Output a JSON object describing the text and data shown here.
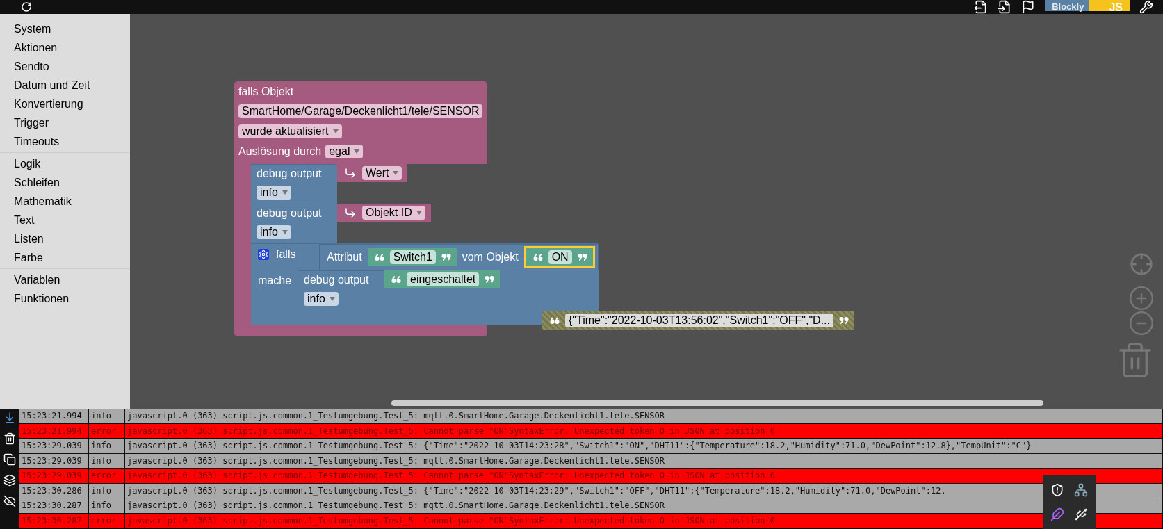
{
  "toolbar": {
    "logo": {
      "left": "Blockly",
      "right": "JS"
    }
  },
  "sidebar": {
    "groups": [
      {
        "items": [
          "System",
          "Aktionen",
          "Sendto",
          "Datum und Zeit",
          "Konvertierung",
          "Trigger",
          "Timeouts"
        ]
      },
      {
        "items": [
          "Logik",
          "Schleifen",
          "Mathematik",
          "Text",
          "Listen",
          "Farbe"
        ]
      },
      {
        "items": [
          "Variablen",
          "Funktionen"
        ]
      }
    ]
  },
  "workspace": {
    "event_block": {
      "title": "falls Objekt",
      "object_id": "SmartHome/Garage/Deckenlicht1/tele/SENSOR",
      "trigger": "wurde aktualisiert",
      "cause_label": "Auslösung durch",
      "cause": "egal",
      "statements": [
        {
          "kind": "debug",
          "label": "debug output",
          "severity": "info",
          "value": {
            "kind": "variable",
            "text": "Wert"
          }
        },
        {
          "kind": "debug",
          "label": "debug output",
          "severity": "info",
          "value": {
            "kind": "variable",
            "text": "Objekt ID"
          }
        },
        {
          "kind": "if",
          "label": "falls",
          "do_label": "mache",
          "condition": {
            "label": "Attribut",
            "attribute": {
              "text": "Switch1",
              "selected": false
            },
            "of_label": "vom Objekt",
            "object": {
              "text": "ON",
              "selected": true
            }
          },
          "statements": [
            {
              "kind": "debug",
              "label": "debug output",
              "severity": "info",
              "value": {
                "kind": "text",
                "text": "eingeschaltet"
              }
            }
          ]
        }
      ]
    },
    "loose_blocks": [
      {
        "kind": "text",
        "text": "{\"Time\":\"2022-10-03T13:56:02\",\"Switch1\":\"OFF\",\"D..."
      }
    ]
  },
  "log": [
    {
      "kind": "info",
      "time": "15:23:21.994",
      "severity": "info",
      "message": "javascript.0 (363) script.js.common.1_Testumgebung.Test_5: mqtt.0.SmartHome.Garage.Deckenlicht1.tele.SENSOR"
    },
    {
      "kind": "error",
      "time": "15:23:21.994",
      "severity": "error",
      "message": "javascript.0 (363) script.js.common.1_Testumgebung.Test_5: Cannot parse \"ON\"SyntaxError: Unexpected token O in JSON at position 0"
    },
    {
      "kind": "info",
      "time": "15:23:29.039",
      "severity": "info",
      "message": "javascript.0 (363) script.js.common.1_Testumgebung.Test_5: {\"Time\":\"2022-10-03T14:23:28\",\"Switch1\":\"ON\",\"DHT11\":{\"Temperature\":18.2,\"Humidity\":71.0,\"DewPoint\":12.8},\"TempUnit\":\"C\"}"
    },
    {
      "kind": "info",
      "time": "15:23:29.039",
      "severity": "info",
      "message": "javascript.0 (363) script.js.common.1_Testumgebung.Test_5: mqtt.0.SmartHome.Garage.Deckenlicht1.tele.SENSOR"
    },
    {
      "kind": "error",
      "time": "15:23:29.039",
      "severity": "error",
      "message": "javascript.0 (363) script.js.common.1_Testumgebung.Test_5: Cannot parse \"ON\"SyntaxError: Unexpected token O in JSON at position 0"
    },
    {
      "kind": "info",
      "time": "15:23:30.286",
      "severity": "info",
      "message": "javascript.0 (363) script.js.common.1_Testumgebung.Test_5: {\"Time\":\"2022-10-03T14:23:29\",\"Switch1\":\"OFF\",\"DHT11\":{\"Temperature\":18.2,\"Humidity\":71.0,\"DewPoint\":12."
    },
    {
      "kind": "info",
      "time": "15:23:30.287",
      "severity": "info",
      "message": "javascript.0 (363) script.js.common.1_Testumgebung.Test_5: mqtt.0.SmartHome.Garage.Deckenlicht1.tele.SENSOR"
    },
    {
      "kind": "error",
      "time": "15:23:30.287",
      "severity": "error",
      "message": "javascript.0 (363) script.js.common.1_Testumgebung.Test_5: Cannot parse \"ON\"SyntaxError: Unexpected token O in JSON at position 0"
    }
  ]
}
